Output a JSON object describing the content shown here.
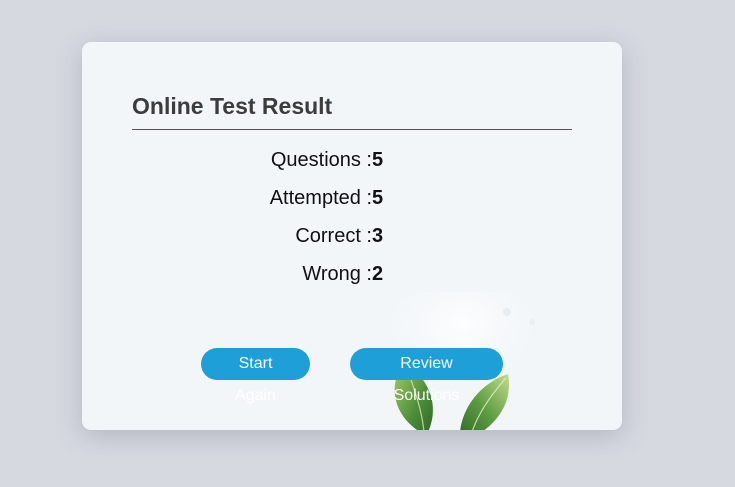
{
  "result": {
    "title": "Online Test Result",
    "stats": [
      {
        "label": "Questions :",
        "value": "5"
      },
      {
        "label": "Attempted :",
        "value": "5"
      },
      {
        "label": "Correct :",
        "value": "3"
      },
      {
        "label": "Wrong :",
        "value": "2"
      }
    ]
  },
  "actions": {
    "start_again": "Start Again",
    "review_solutions": "Review Solutions"
  },
  "colors": {
    "page_background": "#d6d9e0",
    "card_background": "#f2f6f8",
    "button": "#1f9fd8",
    "button_text": "#ffffff",
    "title_text": "#3c3c3c"
  },
  "decoration": {
    "background_image": "plant-leaves"
  }
}
